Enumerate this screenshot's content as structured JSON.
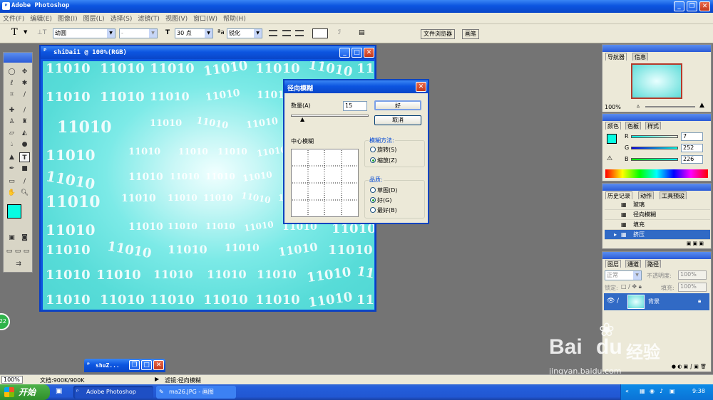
{
  "app": {
    "title": "Adobe Photoshop"
  },
  "menu": [
    "文件(F)",
    "编辑(E)",
    "图像(I)",
    "图层(L)",
    "选择(S)",
    "滤镜(T)",
    "视图(V)",
    "窗口(W)",
    "帮助(H)"
  ],
  "options": {
    "tool_glyph": "T",
    "font_family": "幼圆",
    "font_style": "-",
    "size_value": "30 点",
    "aa_value": "锐化"
  },
  "top_tabs": [
    "文件浏览器",
    "画笔"
  ],
  "document": {
    "title": "shiDai1 @ 100%(RGB)",
    "watermark_text": "11010"
  },
  "dialog": {
    "title": "径向模糊",
    "amount_label": "数量(A)",
    "amount_value": "15",
    "ok": "好",
    "cancel": "取消",
    "center_label": "中心模糊",
    "method_label": "模糊方法:",
    "method_spin": "旋转(S)",
    "method_zoom": "缩放(Z)",
    "quality_label": "品质:",
    "q_draft": "草图(D)",
    "q_good": "好(G)",
    "q_best": "最好(B)"
  },
  "navigator": {
    "tabs": [
      "导航器",
      "信息"
    ],
    "zoom": "100%"
  },
  "color": {
    "tabs": [
      "颜色",
      "色板",
      "样式"
    ],
    "r_label": "R",
    "r_value": "7",
    "g_label": "G",
    "g_value": "252",
    "b_label": "B",
    "b_value": "226",
    "foreground": "#07fce2"
  },
  "history": {
    "tabs": [
      "历史记录",
      "动作",
      "工具预设"
    ],
    "items": [
      "玻璃",
      "径向模糊",
      "填充",
      "挤压"
    ]
  },
  "layers": {
    "tabs": [
      "图层",
      "通道",
      "路径"
    ],
    "mode": "正常",
    "opacity_label": "不透明度:",
    "opacity_value": "100%",
    "lock_label": "锁定:",
    "fill_label": "填充:",
    "fill_value": "100%",
    "layer_name": "背景"
  },
  "status": {
    "zoom": "100%",
    "doc": "文档:900K/900K",
    "info": "滤镜:径向模糊"
  },
  "mini_window": {
    "title": "shuZ..."
  },
  "taskbar": {
    "start": "开始",
    "tasks": [
      "Adobe Photoshop",
      "ma26.JPG - 画图"
    ],
    "clock": "9:38"
  },
  "side_badge": "22",
  "watermark": {
    "brand": "Bai",
    "brand2": "du",
    "cn": "经验",
    "url": "jingyan.baidu.com"
  }
}
